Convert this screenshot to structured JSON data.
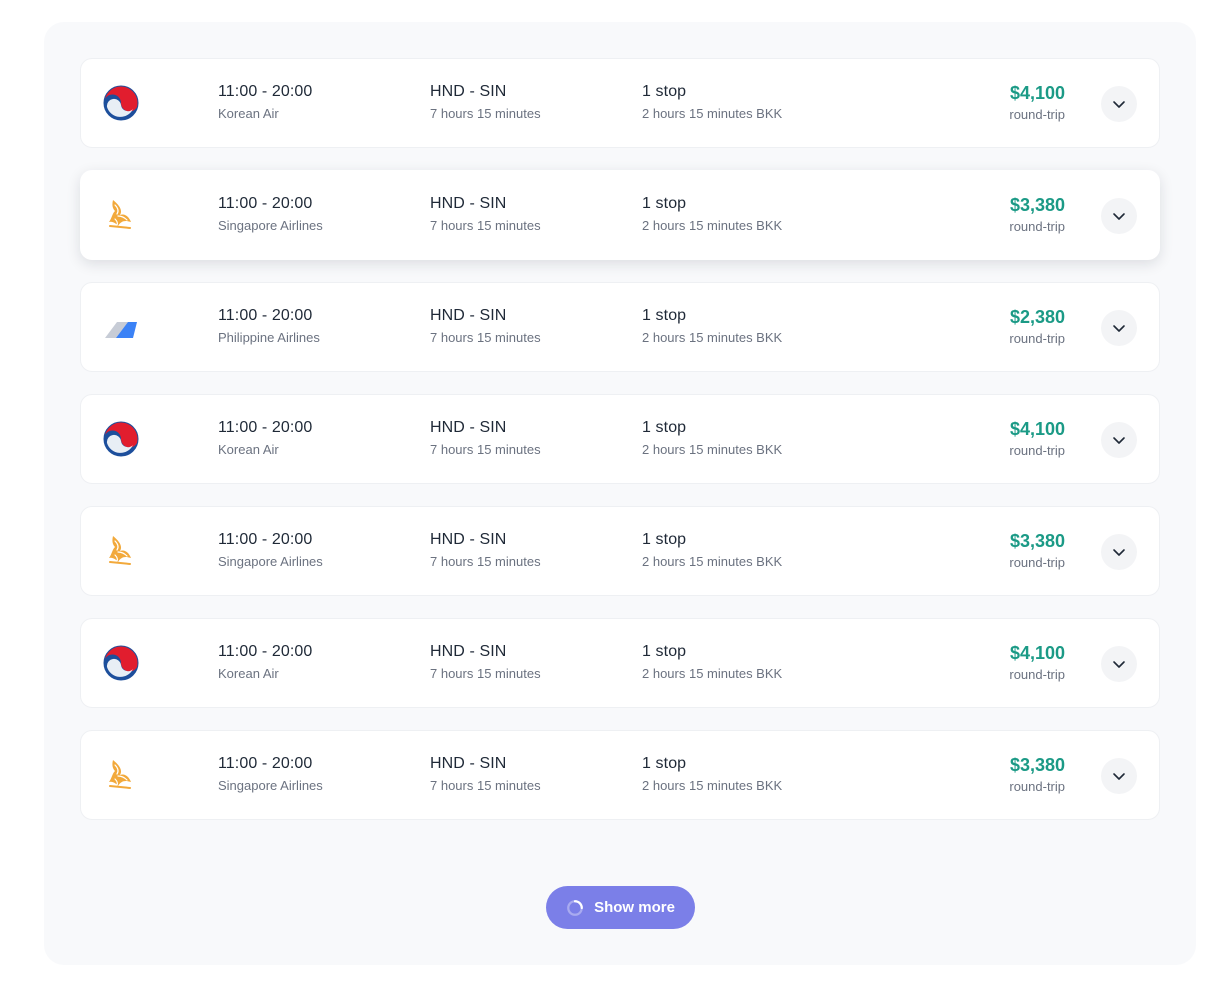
{
  "flights": [
    {
      "logo": "korean-air-logo",
      "times": "11:00 - 20:00",
      "airline": "Korean Air",
      "route": "HND - SIN",
      "duration": "7 hours 15 minutes",
      "stops": "1 stop",
      "layover": "2 hours 15 minutes BKK",
      "price": "$4,100",
      "trip": "round-trip"
    },
    {
      "logo": "singapore-airlines-logo",
      "times": "11:00 - 20:00",
      "airline": "Singapore Airlines",
      "route": "HND - SIN",
      "duration": "7 hours 15 minutes",
      "stops": "1 stop",
      "layover": "2 hours 15 minutes BKK",
      "price": "$3,380",
      "trip": "round-trip",
      "highlighted": true
    },
    {
      "logo": "philippine-airlines-logo",
      "times": "11:00 - 20:00",
      "airline": "Philippine Airlines",
      "route": "HND - SIN",
      "duration": "7 hours 15 minutes",
      "stops": "1 stop",
      "layover": "2 hours 15 minutes BKK",
      "price": "$2,380",
      "trip": "round-trip"
    },
    {
      "logo": "korean-air-logo",
      "times": "11:00 - 20:00",
      "airline": "Korean Air",
      "route": "HND - SIN",
      "duration": "7 hours 15 minutes",
      "stops": "1 stop",
      "layover": "2 hours 15 minutes BKK",
      "price": "$4,100",
      "trip": "round-trip"
    },
    {
      "logo": "singapore-airlines-logo",
      "times": "11:00 - 20:00",
      "airline": "Singapore Airlines",
      "route": "HND - SIN",
      "duration": "7 hours 15 minutes",
      "stops": "1 stop",
      "layover": "2 hours 15 minutes BKK",
      "price": "$3,380",
      "trip": "round-trip"
    },
    {
      "logo": "korean-air-logo",
      "times": "11:00 - 20:00",
      "airline": "Korean Air",
      "route": "HND - SIN",
      "duration": "7 hours 15 minutes",
      "stops": "1 stop",
      "layover": "2 hours 15 minutes BKK",
      "price": "$4,100",
      "trip": "round-trip"
    },
    {
      "logo": "singapore-airlines-logo",
      "times": "11:00 - 20:00",
      "airline": "Singapore Airlines",
      "route": "HND - SIN",
      "duration": "7 hours 15 minutes",
      "stops": "1 stop",
      "layover": "2 hours 15 minutes BKK",
      "price": "$3,380",
      "trip": "round-trip"
    }
  ],
  "expand_icon": "chevron-down-icon",
  "show_more": {
    "label": "Show more",
    "icon": "spinner-icon"
  },
  "colors": {
    "price": "#1b9a86",
    "button": "#7b7fe8",
    "panel": "#f8f9fb"
  }
}
